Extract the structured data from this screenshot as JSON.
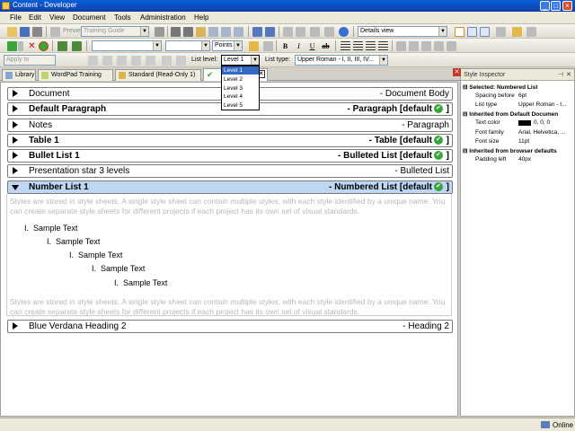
{
  "window": {
    "title": "Content - Developer"
  },
  "menu": [
    "File",
    "Edit",
    "View",
    "Document",
    "Tools",
    "Administration",
    "Help"
  ],
  "toolbar1": {
    "preview_label": "Preview",
    "guide_combo": "Training Guide",
    "view_combo": "Details view"
  },
  "toolbar2": {
    "font_combo": "",
    "size_combo": "",
    "size_unit": "Points",
    "bold": "B",
    "italic": "I",
    "underline": "U"
  },
  "toolbar3": {
    "apply_to": "Apply to",
    "list_level_label": "List level:",
    "list_level_value": "Level 1",
    "list_type_label": "List type:",
    "list_type_value": "Upper Roman - I, II, III, IV..."
  },
  "tabs": [
    {
      "label": "Library"
    },
    {
      "label": "WordPad Training"
    },
    {
      "label": "Standard (Read-Only 1)"
    },
    {
      "label": ""
    }
  ],
  "list_level_options": [
    "Level 1",
    "Level 2",
    "Level 3",
    "Level 4",
    "Level 5"
  ],
  "styles": [
    {
      "name": "Document",
      "type": "- Document Body"
    },
    {
      "name": "Default Paragraph",
      "type": "- Paragraph [default ]"
    },
    {
      "name": "Notes",
      "type": "- Paragraph"
    },
    {
      "name": "Table 1",
      "type": "- Table [default ]"
    },
    {
      "name": "Bullet List 1",
      "type": "- Bulleted List [default ]"
    },
    {
      "name": "Presentation star 3 levels",
      "type": "- Bulleted List"
    },
    {
      "name": "Number List 1",
      "type": "- Numbered List [default ]"
    },
    {
      "name": "Blue Verdana Heading 2",
      "type": "- Heading 2"
    }
  ],
  "preview": {
    "paragraph": "Styles are stored in style sheets. A single style sheet can contain multiple styles, with each style identified by a unique name. You can create separate style sheets for different projects if each project has its own set of visual standards.",
    "items": [
      {
        "marker": "I.",
        "text": "Sample Text"
      },
      {
        "marker": "I.",
        "text": "Sample Text"
      },
      {
        "marker": "I.",
        "text": "Sample Text"
      },
      {
        "marker": "I.",
        "text": "Sample Text"
      },
      {
        "marker": "I.",
        "text": "Sample Text"
      }
    ]
  },
  "inspector": {
    "title": "Style Inspector",
    "sections": [
      {
        "header": "Selected: Numbered List",
        "rows": [
          {
            "label": "Spacing before",
            "value": "6pt"
          },
          {
            "label": "List type",
            "value": "Upper Roman - I..."
          }
        ]
      },
      {
        "header": "Inherited from Default Documen",
        "rows": [
          {
            "label": "Text color",
            "value": "0, 0, 0"
          },
          {
            "label": "Font family",
            "value": "Arial, Helvetica, ..."
          },
          {
            "label": "Font size",
            "value": "11pt"
          }
        ]
      },
      {
        "header": "Inherited from browser defaults",
        "rows": [
          {
            "label": "Padding left",
            "value": "40px"
          }
        ]
      }
    ]
  },
  "status": {
    "label": "Online"
  },
  "colors": {
    "title_bar": "#0f3fa8",
    "selection": "#316ac5",
    "expanded_row": "#bfd7f3",
    "default_check": "#3aa53a"
  }
}
